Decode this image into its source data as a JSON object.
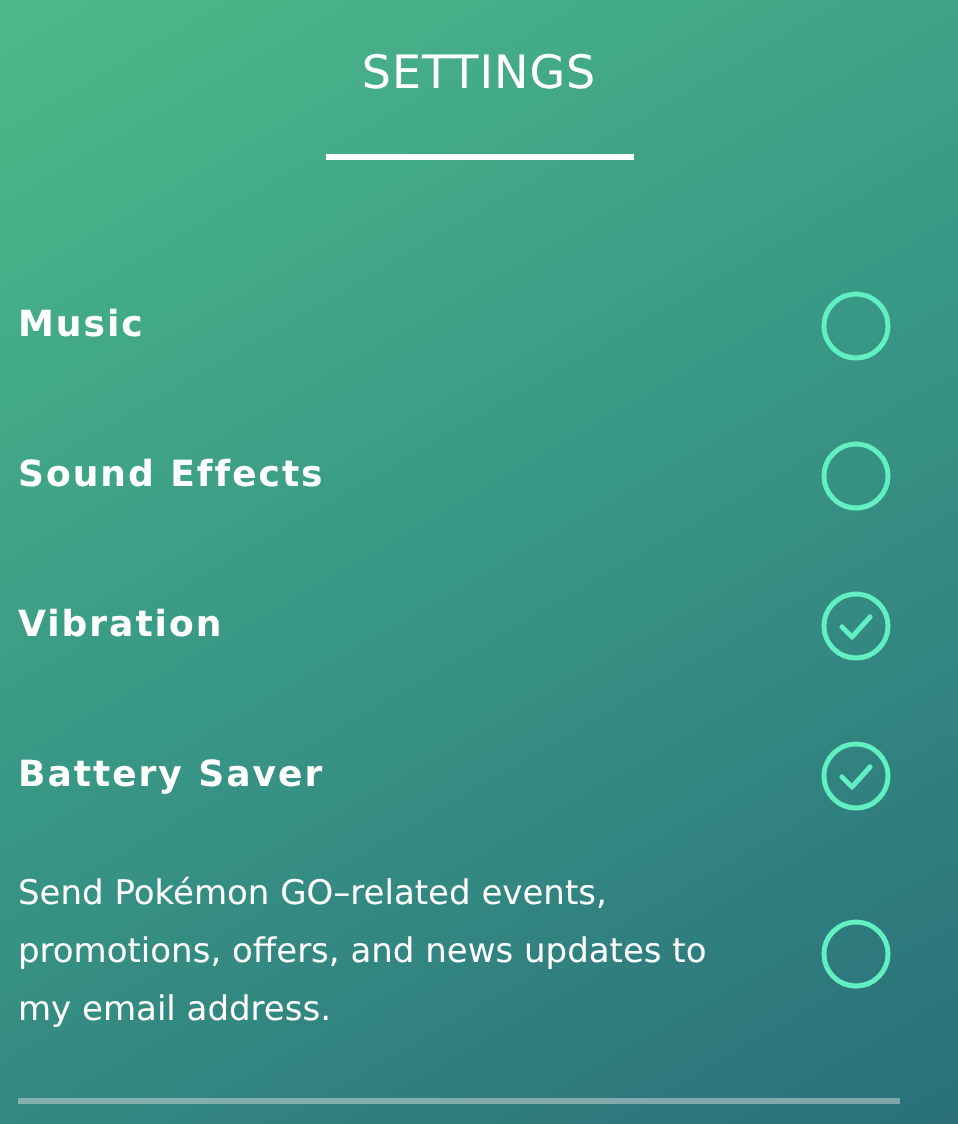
{
  "title": "SETTINGS",
  "settings": [
    {
      "kind": "option",
      "label": "Music",
      "checked": false
    },
    {
      "kind": "option",
      "label": "Sound Effects",
      "checked": false
    },
    {
      "kind": "option",
      "label": "Vibration",
      "checked": true
    },
    {
      "kind": "option",
      "label": "Battery Saver",
      "checked": true
    },
    {
      "kind": "consent",
      "label": "Send Pokémon GO–related events, promotions, offers, and news updates to my email address.",
      "checked": false
    }
  ]
}
